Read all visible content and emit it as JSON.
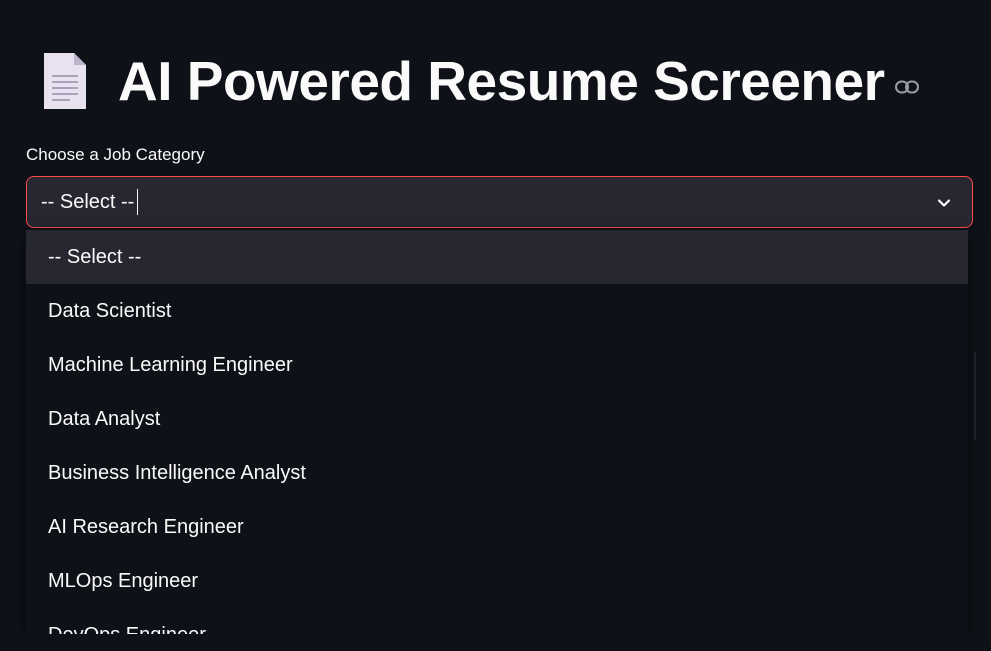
{
  "header": {
    "icon": "document-icon",
    "title": "AI Powered Resume Screener",
    "anchor_icon": "link-icon"
  },
  "form": {
    "label": "Choose a Job Category",
    "select": {
      "value": "-- Select --",
      "chevron_icon": "chevron-down-icon"
    }
  },
  "dropdown": {
    "options": [
      "-- Select --",
      "Data Scientist",
      "Machine Learning Engineer",
      "Data Analyst",
      "Business Intelligence Analyst",
      "AI Research Engineer",
      "MLOps Engineer",
      "DevOps Engineer"
    ],
    "selected_index": 0
  },
  "colors": {
    "background": "#0e1117",
    "surface": "#262730",
    "accent": "#ff4b4b",
    "text": "#fafafa"
  }
}
